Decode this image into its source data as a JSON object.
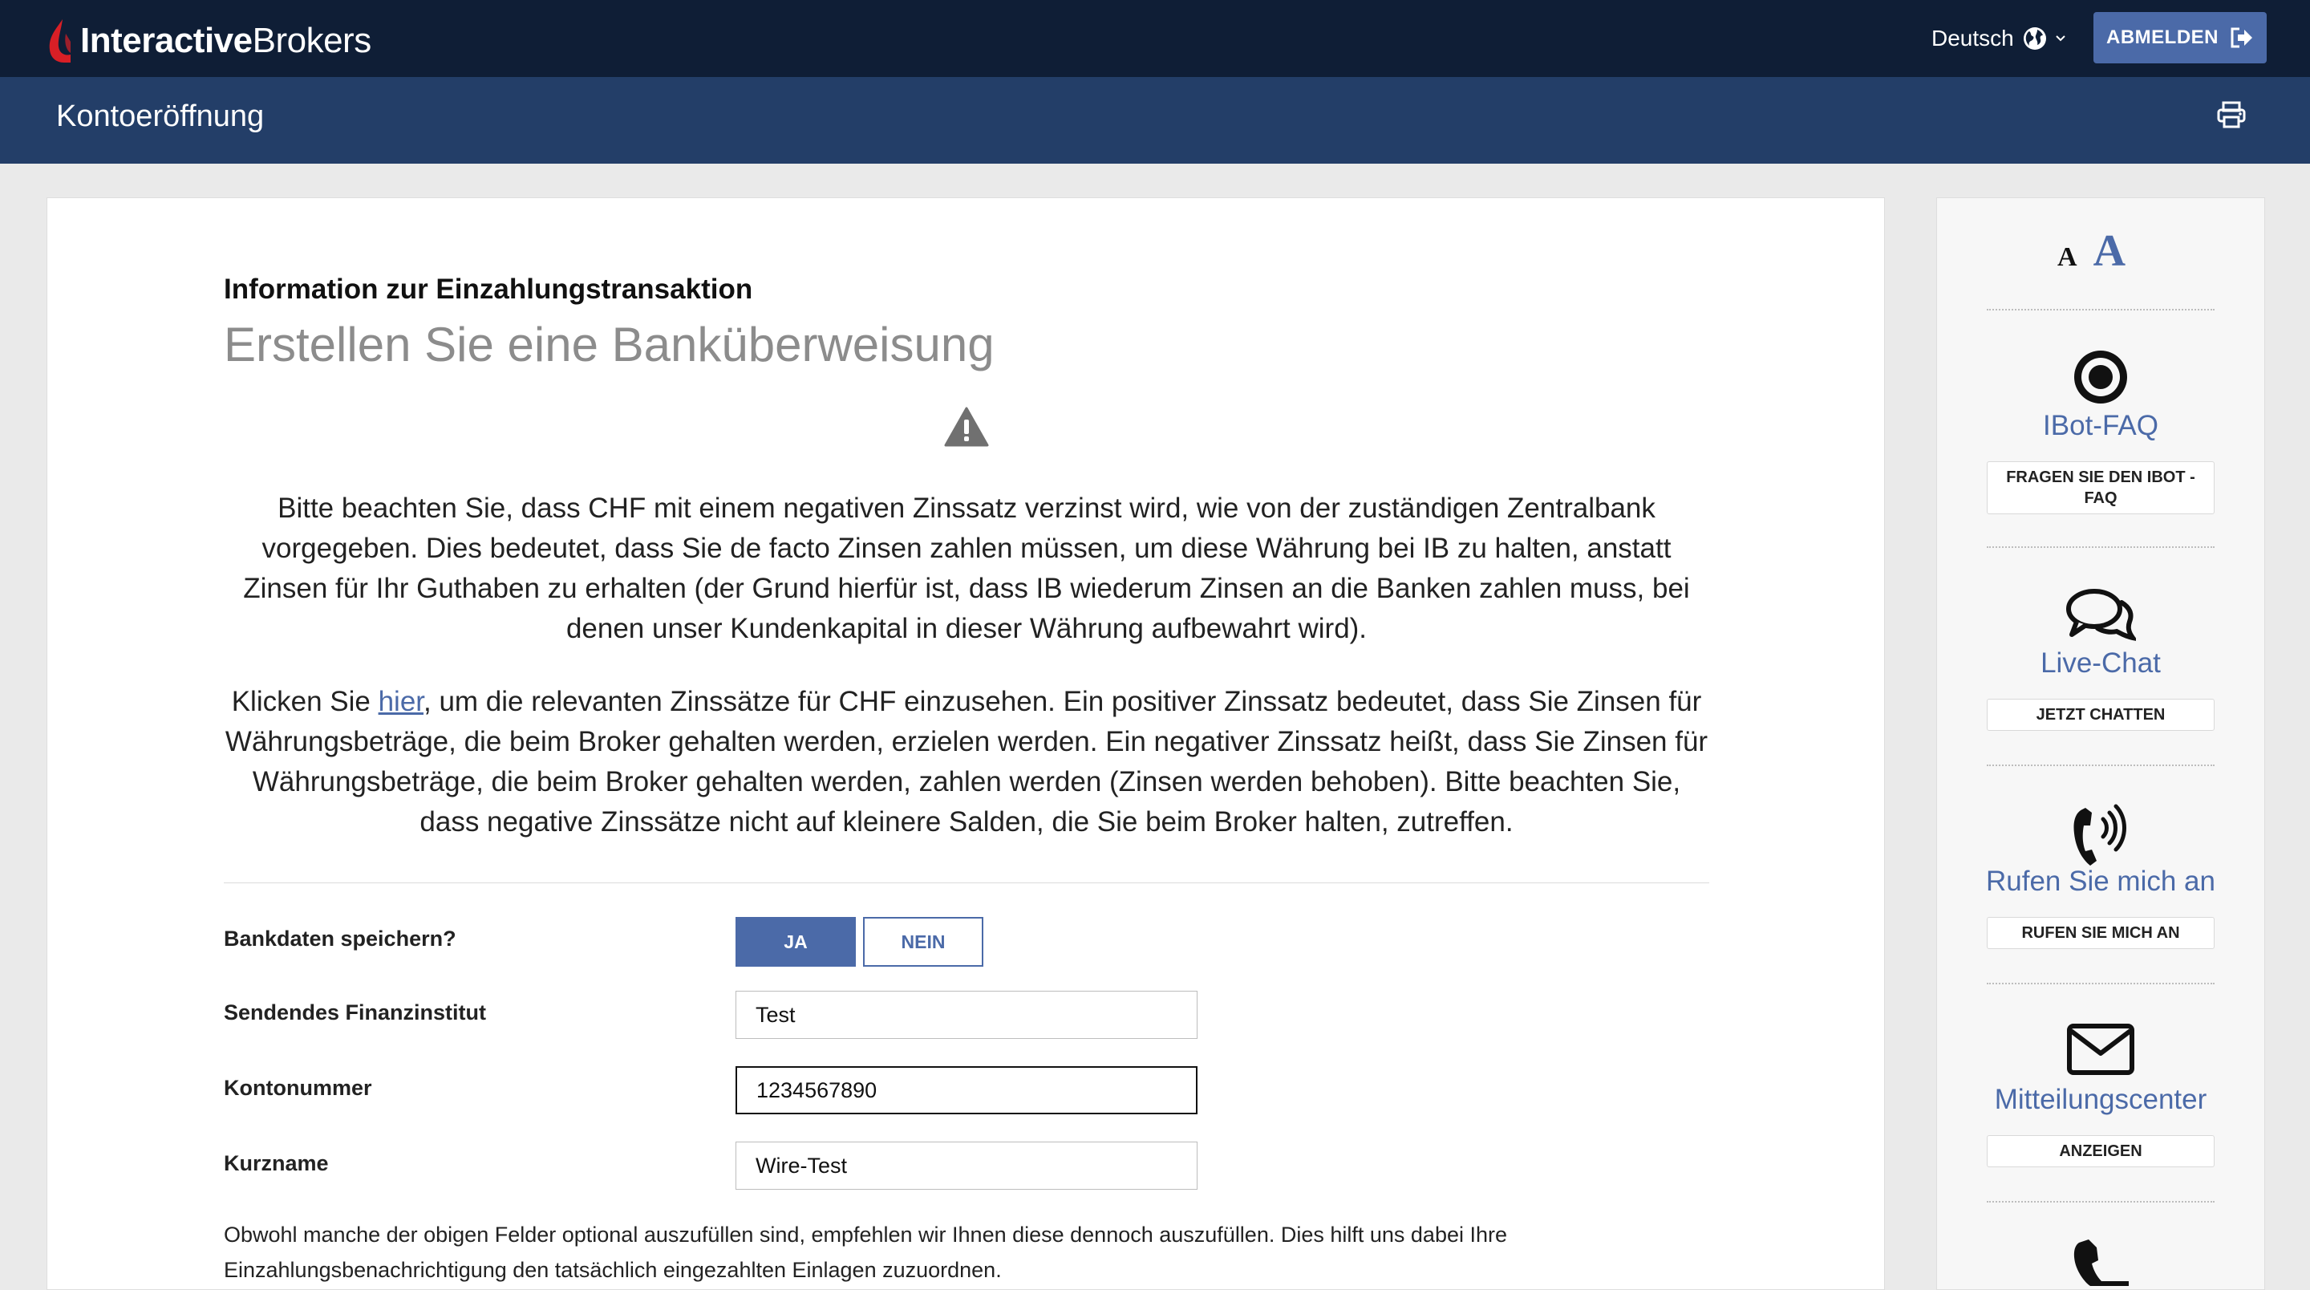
{
  "header": {
    "logo_bold": "Interactive",
    "logo_light": "Brokers",
    "language": "Deutsch",
    "logout_label": "ABMELDEN"
  },
  "subheader": {
    "title": "Kontoeröffnung"
  },
  "main": {
    "section_label": "Information zur Einzahlungstransaktion",
    "title": "Erstellen Sie eine Banküberweisung",
    "warning_text": "Bitte beachten Sie, dass CHF mit einem negativen Zinssatz verzinst wird, wie von der zuständigen Zentralbank vorgegeben. Dies bedeutet, dass Sie de facto Zinsen zahlen müssen, um diese Währung bei IB zu halten, anstatt Zinsen für Ihr Guthaben zu erhalten (der Grund hierfür ist, dass IB wiederum Zinsen an die Banken zahlen muss, bei denen unser Kundenkapital in dieser Währung aufbewahrt wird).",
    "rates_prefix": "Klicken Sie ",
    "rates_link": "hier",
    "rates_suffix": ", um die relevanten Zinssätze für CHF einzusehen. Ein positiver Zinssatz bedeutet, dass Sie Zinsen für Währungsbeträge, die beim Broker gehalten werden, erzielen werden. Ein negativer Zinssatz heißt, dass Sie Zinsen für Währungsbeträge, die beim Broker gehalten werden, zahlen werden (Zinsen werden behoben). Bitte beachten Sie, dass negative Zinssätze nicht auf kleinere Salden, die Sie beim Broker halten, zutreffen.",
    "form": {
      "save_label": "Bankdaten speichern?",
      "yes_label": "JA",
      "no_label": "NEIN",
      "save_selected": "JA",
      "institution_label": "Sendendes Finanzinstitut",
      "institution_value": "Test",
      "account_label": "Kontonummer",
      "account_value": "1234567890",
      "shortname_label": "Kurzname",
      "shortname_value": "Wire-Test"
    },
    "note": "Obwohl manche der obigen Felder optional auszufüllen sind, empfehlen wir Ihnen diese dennoch auszufüllen. Dies hilft uns dabei Ihre Einzahlungsbenachrichtigung den tatsächlich eingezahlten Einlagen zuzuordnen."
  },
  "sidebar": {
    "font_small": "A",
    "font_large": "A",
    "items": [
      {
        "title": "IBot-FAQ",
        "button": "FRAGEN SIE DEN IBOT - FAQ",
        "icon": "ibot-icon"
      },
      {
        "title": "Live-Chat",
        "button": "JETZT CHATTEN",
        "icon": "chat-icon"
      },
      {
        "title": "Rufen Sie mich an",
        "button": "RUFEN SIE MICH AN",
        "icon": "callback-phone-icon"
      },
      {
        "title": "Mitteilungscenter",
        "button": "ANZEIGEN",
        "icon": "envelope-icon"
      }
    ]
  },
  "colors": {
    "topbar": "#0f1e36",
    "subbar": "#233e68",
    "accent": "#4b6aa8",
    "logo_red": "#d81f26"
  }
}
